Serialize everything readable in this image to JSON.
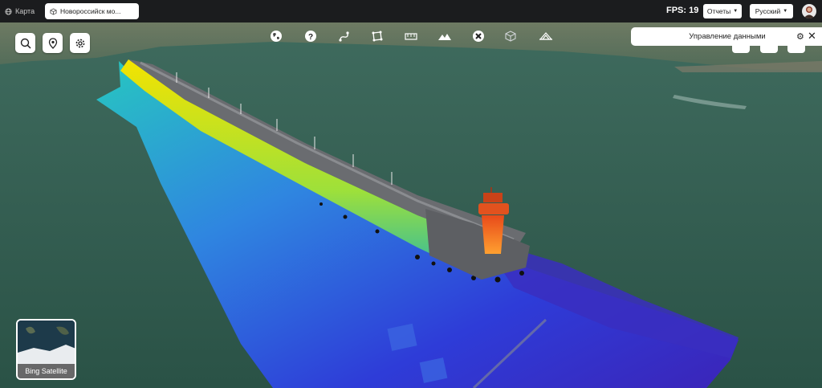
{
  "tabs": [
    {
      "label": "Карта",
      "icon": "globe-icon",
      "active": false
    },
    {
      "label": "Новороссийск мо...",
      "icon": "cube-icon",
      "active": true
    }
  ],
  "header": {
    "fps_label": "FPS: 19",
    "reports_label": "Отчеты",
    "language_label": "Русский"
  },
  "toolbar": {
    "tools": [
      "globe-icon",
      "help-icon",
      "route-measure-icon",
      "polygon-area-icon",
      "profile-ruler-icon",
      "terrain-icon",
      "close-circle-icon",
      "box-volume-icon",
      "slope-icon"
    ]
  },
  "left_controls": [
    "search-icon",
    "location-pin-icon",
    "settings-gear-icon"
  ],
  "data_panel": {
    "title": "Управление данными"
  },
  "basemap": {
    "label": "Bing Satellite"
  },
  "colors": {
    "topbar": "#1b1c1e",
    "sea": "#2f5a4e",
    "pointcloud_low": "#2e2bd6",
    "pointcloud_mid": "#27c7c0",
    "pointcloud_high": "#f4d000",
    "lighthouse": "#e0511f"
  }
}
